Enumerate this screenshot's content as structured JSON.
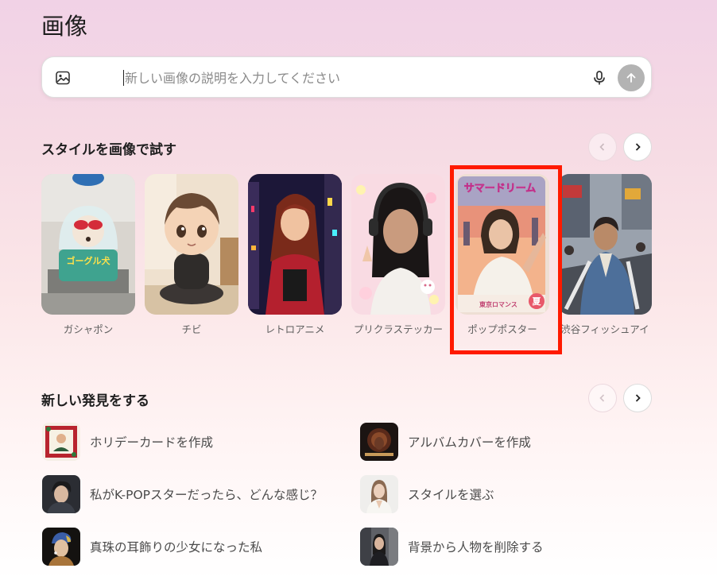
{
  "page": {
    "title": "画像"
  },
  "search": {
    "placeholder": "新しい画像の説明を入力してください",
    "value": "",
    "icons": [
      "image-icon",
      "microphone-icon",
      "arrow-up-icon"
    ]
  },
  "styles_section": {
    "title": "スタイルを画像で試す",
    "items": [
      {
        "label": "ガシャポン"
      },
      {
        "label": "チビ"
      },
      {
        "label": "レトロアニメ"
      },
      {
        "label": "プリクラステッカー"
      },
      {
        "label": "ポップポスター",
        "poster_title": "サマードリーム",
        "poster_footer": "東京ロマンス",
        "poster_badge": "夏",
        "highlighted": true
      },
      {
        "label": "渋谷フィッシュアイ"
      }
    ],
    "highlight_color": "#ff1a00"
  },
  "gashapon_text": "ゴーグル犬",
  "discover_section": {
    "title": "新しい発見をする",
    "items": [
      {
        "label": "ホリデーカードを作成"
      },
      {
        "label": "アルバムカバーを作成"
      },
      {
        "label": "私がK-POPスターだったら、どんな感じ？"
      },
      {
        "label": "スタイルを選ぶ"
      },
      {
        "label": "真珠の耳飾りの少女になった私"
      },
      {
        "label": "背景から人物を削除する"
      }
    ]
  }
}
